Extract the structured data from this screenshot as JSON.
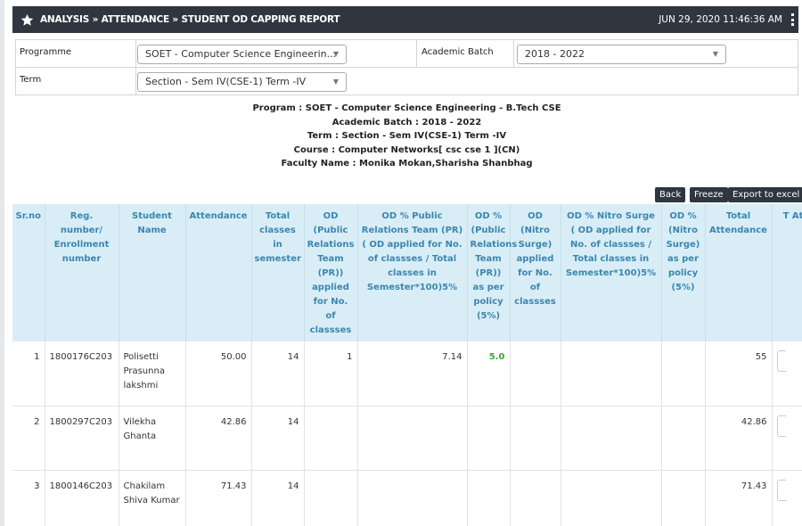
{
  "header": {
    "title": "ANALYSIS » ATTENDANCE » STUDENT OD CAPPING REPORT",
    "datetime": "JUN 29, 2020  11:46:36 AM"
  },
  "filters": {
    "programme_label": "Programme",
    "programme_value": "SOET - Computer Science Engineerin...",
    "batch_label": "Academic Batch",
    "batch_value": "2018 - 2022",
    "term_label": "Term",
    "term_value": "Section - Sem IV(CSE-1) Term -IV"
  },
  "info": {
    "program": "Program : SOET - Computer Science Engineering - B.Tech CSE",
    "batch": "Academic Batch : 2018 - 2022",
    "term": "Term : Section - Sem IV(CSE-1) Term -IV",
    "course": "Course : Computer Networks[ csc cse 1 ](CN)",
    "faculty": "Faculty Name : Monika Mokan,Sharisha Shanbhag"
  },
  "actions": {
    "back": "Back",
    "freeze": "Freeze",
    "export": "Export to excel"
  },
  "table": {
    "headers": [
      "Sr.no",
      "Reg. number/ Enrollment number",
      "Student Name",
      "Attendance",
      "Total classes in semester",
      "OD (Public Relations Team (PR)) applied for No. of classses",
      "OD % Public Relations Team (PR) ( OD applied for No. of classses / Total classes in Semester*100)5%",
      "OD % (Public Relations Team (PR)) as per policy (5%)",
      "OD (Nitro Surge) applied for No. of classses",
      "OD % Nitro Surge ( OD applied for No. of classses / Total classes in Semester*100)5%",
      "OD % (Nitro Surge) as per policy (5%)",
      "Total Attendance",
      "T At"
    ],
    "rows": [
      {
        "sr": "1",
        "reg": "1800176C203",
        "name": "Polisetti Prasunna lakshmi",
        "attendance": "50.00",
        "total": "14",
        "od_pr": "1",
        "od_pr_pct": "7.14",
        "od_pr_policy": "5.0",
        "od_ns": "",
        "od_ns_pct": "",
        "od_ns_policy": "",
        "total_att": "55"
      },
      {
        "sr": "2",
        "reg": "1800297C203",
        "name": "Vilekha Ghanta",
        "attendance": "42.86",
        "total": "14",
        "od_pr": "",
        "od_pr_pct": "",
        "od_pr_policy": "",
        "od_ns": "",
        "od_ns_pct": "",
        "od_ns_policy": "",
        "total_att": "42.86"
      },
      {
        "sr": "3",
        "reg": "1800146C203",
        "name": "Chakilam Shiva Kumar",
        "attendance": "71.43",
        "total": "14",
        "od_pr": "",
        "od_pr_pct": "",
        "od_pr_policy": "",
        "od_ns": "",
        "od_ns_pct": "",
        "od_ns_policy": "",
        "total_att": "71.43"
      }
    ]
  }
}
